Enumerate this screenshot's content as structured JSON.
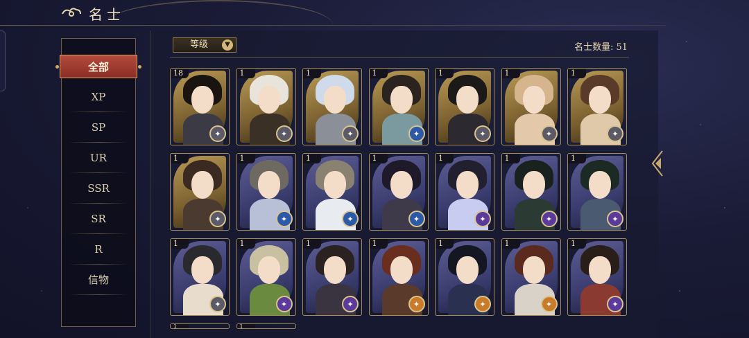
{
  "header": {
    "title": "名士"
  },
  "filters": [
    {
      "label": "全部",
      "active": true
    },
    {
      "label": "XP"
    },
    {
      "label": "SP"
    },
    {
      "label": "UR"
    },
    {
      "label": "SSR"
    },
    {
      "label": "SR"
    },
    {
      "label": "R"
    },
    {
      "label": "信物"
    }
  ],
  "toolbar": {
    "sort_label": "等级",
    "count_label": "名士数量:",
    "count_value": "51"
  },
  "cards": [
    {
      "level": "18",
      "frame": "gold",
      "hair": "#1a1411",
      "body": "#3c3a44",
      "badge": "gray"
    },
    {
      "level": "1",
      "frame": "gold",
      "hair": "#e8e4dc",
      "body": "#3a3026",
      "badge": "gray"
    },
    {
      "level": "1",
      "frame": "gold",
      "hair": "#cfdbea",
      "body": "#8a8f98",
      "badge": "gray"
    },
    {
      "level": "1",
      "frame": "gold",
      "hair": "#2a2320",
      "body": "#7a9aa0",
      "badge": "blue"
    },
    {
      "level": "1",
      "frame": "gold",
      "hair": "#1c1a18",
      "body": "#2c2a30",
      "badge": "gray"
    },
    {
      "level": "1",
      "frame": "gold",
      "hair": "#d6b58e",
      "body": "#e4c8aa",
      "badge": "gray"
    },
    {
      "level": "1",
      "frame": "gold",
      "hair": "#5a3a28",
      "body": "#e0c9a8",
      "badge": "gray"
    },
    {
      "level": "1",
      "frame": "gold",
      "hair": "#3a2a22",
      "body": "#4a3a30",
      "badge": "gray"
    },
    {
      "level": "1",
      "frame": "purple",
      "hair": "#6e6a62",
      "body": "#b8c0d8",
      "badge": "blue"
    },
    {
      "level": "1",
      "frame": "purple",
      "hair": "#8a8270",
      "body": "#e8ecf0",
      "badge": "blue"
    },
    {
      "level": "1",
      "frame": "purple",
      "hair": "#1e1a2a",
      "body": "#3e3a4a",
      "badge": "blue"
    },
    {
      "level": "1",
      "frame": "purple",
      "hair": "#22202e",
      "body": "#c8ccf0",
      "badge": "purple"
    },
    {
      "level": "1",
      "frame": "purple",
      "hair": "#1a2220",
      "body": "#2c3a34",
      "badge": "purple"
    },
    {
      "level": "1",
      "frame": "purple",
      "hair": "#1c2a24",
      "body": "#4a5a70",
      "badge": "purple"
    },
    {
      "level": "1",
      "frame": "purple",
      "hair": "#2a2a2e",
      "body": "#e8dccc",
      "badge": "gray"
    },
    {
      "level": "1",
      "frame": "purple",
      "hair": "#c8c0a0",
      "body": "#6a8a40",
      "badge": "purple"
    },
    {
      "level": "1",
      "frame": "purple",
      "hair": "#2a2220",
      "body": "#3a3440",
      "badge": "purple"
    },
    {
      "level": "1",
      "frame": "purple",
      "hair": "#6a2e1e",
      "body": "#5a3a2a",
      "badge": "orange"
    },
    {
      "level": "1",
      "frame": "purple",
      "hair": "#141622",
      "body": "#2a3050",
      "badge": "orange"
    },
    {
      "level": "1",
      "frame": "purple",
      "hair": "#5a2a1e",
      "body": "#d8d2c8",
      "badge": "orange"
    },
    {
      "level": "1",
      "frame": "purple",
      "hair": "#2a1e18",
      "body": "#8a3a30",
      "badge": "purple"
    }
  ],
  "partial_cards": [
    {
      "level": "1"
    },
    {
      "level": "1"
    }
  ]
}
